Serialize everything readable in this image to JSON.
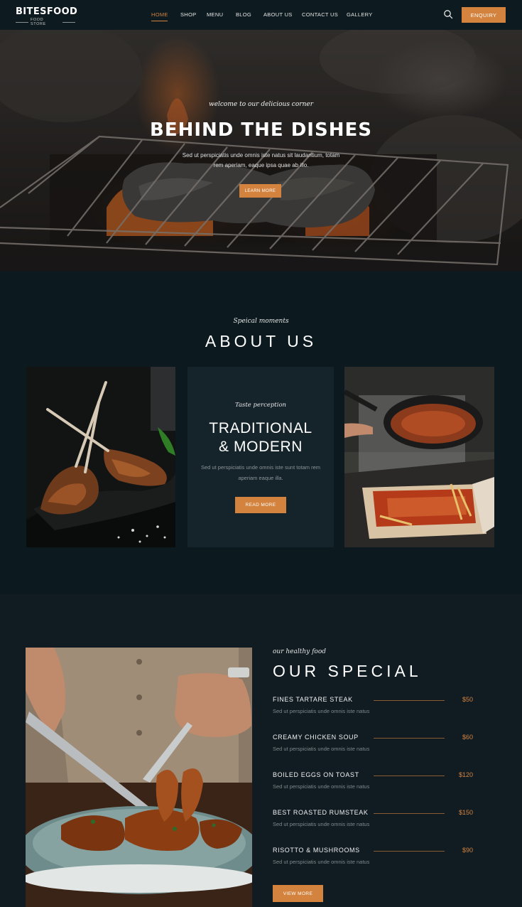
{
  "brand": {
    "name": "BITESFOOD",
    "tagline": "FOOD STORE"
  },
  "nav": {
    "items": [
      "HOME",
      "SHOP",
      "MENU",
      "BLOG",
      "ABOUT US",
      "CONTACT US",
      "GALLERY"
    ],
    "active": "HOME",
    "search_icon": "search-icon",
    "enquiry_label": "ENQUIRY"
  },
  "hero": {
    "tagline": "welcome to our delicious corner",
    "title": "BEHIND THE DISHES",
    "text": "Sed ut perspiciatis unde omnis iste natus sit laudantium, totam rem aperiam, eaque ipsa quae ab illo.",
    "button": "LEARN MORE"
  },
  "about": {
    "tagline": "Speical moments",
    "title": "ABOUT US",
    "card": {
      "tagline": "Taste perception",
      "title_line1": "TRADITIONAL",
      "title_line2": "& MODERN",
      "text": "Sed ut perspiciatis unde omnis iste sunt totam rem aperiam eaque illa.",
      "button": "READ MORE"
    }
  },
  "special": {
    "tagline": "our healthy food",
    "title": "OUR SPECIAL",
    "items": [
      {
        "name": "FINES TARTARE STEAK",
        "price": "$50",
        "desc": "Sed ut perspiciatis unde omnis iste natus"
      },
      {
        "name": "CREAMY CHICKEN SOUP",
        "price": "$60",
        "desc": "Sed ut perspiciatis unde omnis iste natus"
      },
      {
        "name": "BOILED EGGS ON TOAST",
        "price": "$120",
        "desc": "Sed ut perspiciatis unde omnis iste natus"
      },
      {
        "name": "BEST ROASTED RUMSTEAK",
        "price": "$150",
        "desc": "Sed ut perspiciatis unde omnis iste natus"
      },
      {
        "name": "RISOTTO & MUSHROOMS",
        "price": "$90",
        "desc": "Sed ut perspiciatis unde omnis iste natus"
      }
    ],
    "button": "VIEW MORE"
  },
  "colors": {
    "accent": "#d4833f",
    "background": "#0c1a20",
    "card": "#15232a"
  }
}
